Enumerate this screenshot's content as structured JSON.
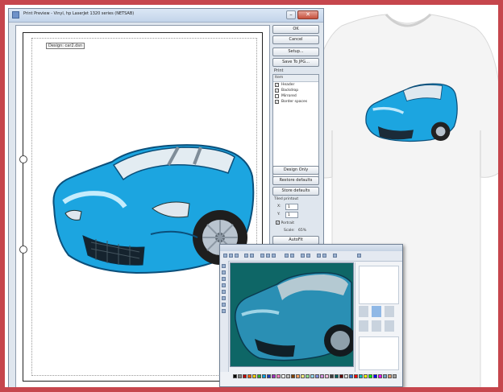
{
  "print_preview": {
    "title": "Print Preview - Vinyl, hp LaserJet 1320 series (NETSAB)",
    "design_label": "Design: car2.dsn",
    "buttons": {
      "ok": "OK",
      "cancel": "Cancel",
      "setup": "Setup...",
      "save_jpg": "Save To JPG...",
      "design_only": "Design Only",
      "restore_defaults": "Restore defaults",
      "store_defaults": "Store defaults",
      "autofit": "AutoFit"
    },
    "print_group": {
      "label": "Print",
      "list_header": "Item",
      "items": [
        {
          "label": "Header",
          "checked": true
        },
        {
          "label": "Backdrop",
          "checked": true
        },
        {
          "label": "Mirrored",
          "checked": false
        },
        {
          "label": "Border spaces",
          "checked": true
        }
      ]
    },
    "tiled_printout": {
      "label": "Tiled printout",
      "x_label": "X:",
      "x_value": "1",
      "y_label": "Y:",
      "y_value": "1",
      "portrait_label": "Portrait",
      "scale_label": "Scale:",
      "scale_value": "65%"
    }
  },
  "colors": {
    "frame_border": "#c6464d",
    "car_body": "#1ca5e0",
    "paint_canvas": "#0e6666"
  }
}
